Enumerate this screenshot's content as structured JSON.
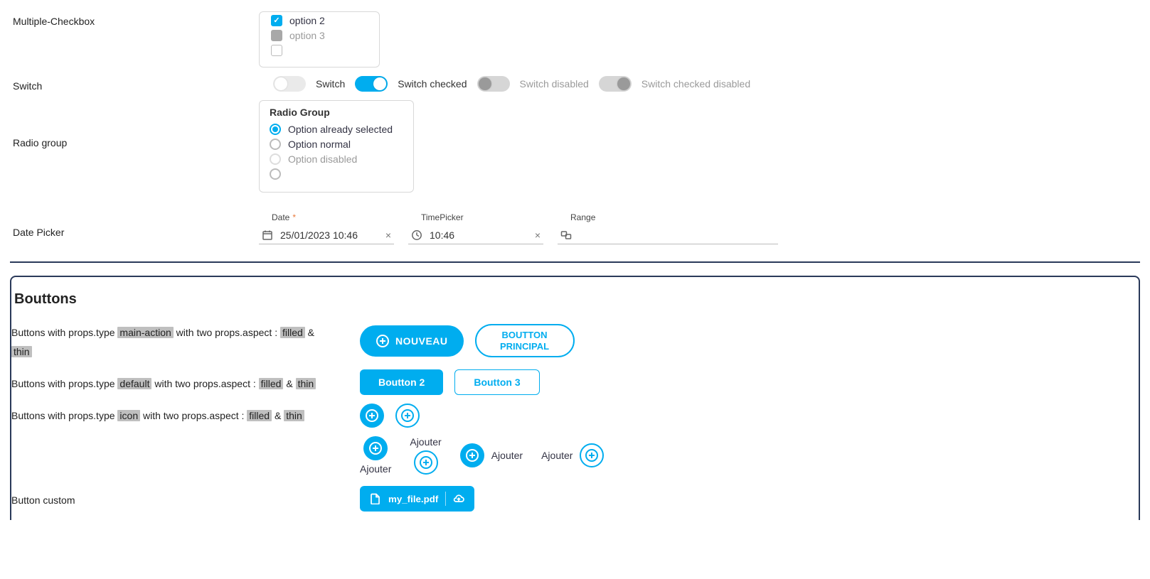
{
  "multipleCheckbox": {
    "label": "Multiple-Checkbox",
    "option2": "option 2",
    "option3": "option 3"
  },
  "switchRow": {
    "label": "Switch",
    "s1": "Switch",
    "s2": "Switch checked",
    "s3": "Switch disabled",
    "s4": "Switch checked disabled"
  },
  "radioGroup": {
    "label": "Radio group",
    "title": "Radio Group",
    "opt1": "Option already selected",
    "opt2": "Option normal",
    "opt3": "Option disabled"
  },
  "datePicker": {
    "label": "Date Picker",
    "dateLabel": "Date",
    "dateValue": "25/01/2023 10:46",
    "timeLabel": "TimePicker",
    "timeValue": "10:46",
    "rangeLabel": "Range"
  },
  "buttonsSection": {
    "title": "Bouttons",
    "desc1_a": "Buttons with props.type ",
    "desc1_chip1": "main-action",
    "desc1_b": " with two props.aspect : ",
    "desc1_chip2": "filled",
    "desc1_amp": " & ",
    "desc1_chip3": "thin",
    "desc2_a": "Buttons with props.type ",
    "desc2_chip1": "default",
    "desc2_b": " with two props.aspect : ",
    "desc2_chip2": "filled",
    "desc2_amp": " & ",
    "desc2_chip3": "thin",
    "desc3_a": "Buttons with props.type ",
    "desc3_chip1": "icon",
    "desc3_b": " with two props.aspect : ",
    "desc3_chip2": "filled",
    "desc3_amp": " & ",
    "desc3_chip3": "thin",
    "btnNouveau": "NOUVEAU",
    "btnPrincipal": "BOUTTON PRINCIPAL",
    "btn2": "Boutton 2",
    "btn3": "Boutton 3",
    "ajouter": "Ajouter",
    "customLabel": "Button custom",
    "fileName": "my_file.pdf"
  }
}
